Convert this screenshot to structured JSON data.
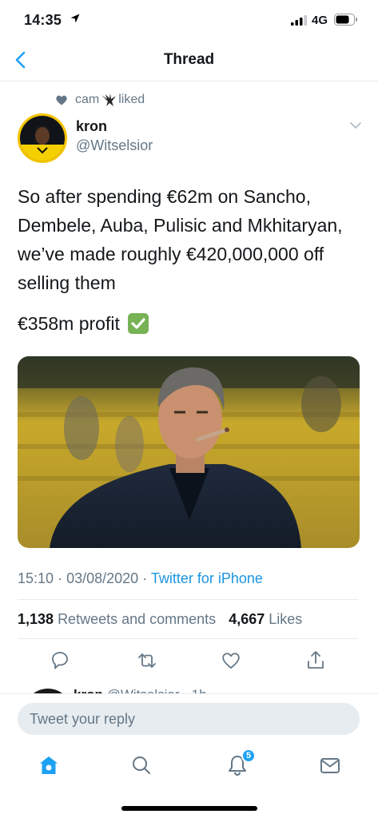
{
  "status_bar": {
    "time": "14:35",
    "network": "4G"
  },
  "nav": {
    "title": "Thread"
  },
  "social_context": {
    "prefix": "cam",
    "suffix": "liked"
  },
  "tweet": {
    "author_name": "kron",
    "author_handle": "@Witselsior",
    "text_main": "So after spending €62m on Sancho, Dembele, Auba, Pulisic and Mkhitaryan, we’ve made roughly €420,000,000 off selling them",
    "text_profit": "€358m profit",
    "time": "15:10",
    "date": "03/08/2020",
    "source": "Twitter for iPhone",
    "retweets_count": "1,138",
    "retweets_label": "Retweets and comments",
    "likes_count": "4,667",
    "likes_label": "Likes"
  },
  "next_tweet": {
    "author": "kron",
    "handle": "@Witselsior",
    "age": "1h"
  },
  "reply": {
    "placeholder": "Tweet your reply"
  },
  "tab_bar": {
    "notifications_badge": "5"
  },
  "colors": {
    "accent": "#1da1f2",
    "link": "#1b95e0",
    "muted": "#657786"
  }
}
